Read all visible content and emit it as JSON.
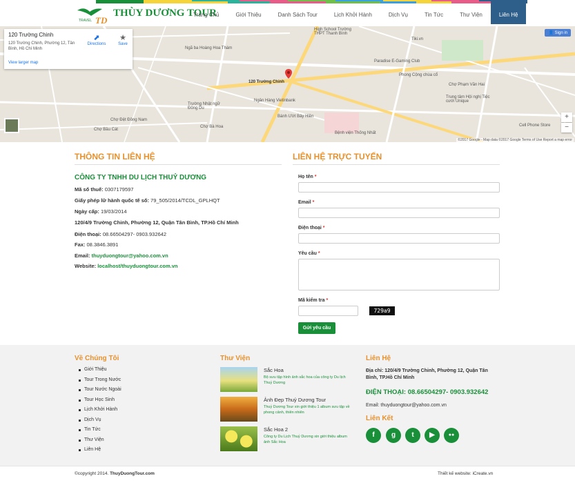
{
  "brand": {
    "logo_small": "TRAVEL",
    "logo_mark": "TD",
    "name": "THÙY DƯƠNG TOUR",
    "green": "#1a8f3a",
    "orange": "#e8912c",
    "nav_active_bg": "#2e5f8a"
  },
  "nav": [
    {
      "label": "Trang Chủ",
      "color": "#f5d43b"
    },
    {
      "label": "Giới Thiệu",
      "color": "#2bb39b"
    },
    {
      "label": "Danh Sách Tour",
      "color": "#e85c8a"
    },
    {
      "label": "Lịch Khởi Hành",
      "color": "#6fc04a"
    },
    {
      "label": "Dịch Vụ",
      "color": "#3aa0e0"
    },
    {
      "label": "Tin Tức",
      "color": "#f5d43b"
    },
    {
      "label": "Thư Viện",
      "color": "#e85c8a"
    },
    {
      "label": "Liên Hệ",
      "color": "#2e5f8a"
    }
  ],
  "map": {
    "place_title": "120 Trường Chinh",
    "place_address": "120 Trường Chinh, Phường 12, Tân Bình, Hồ Chí Minh",
    "directions": "Directions",
    "save": "Save",
    "larger": "View larger map",
    "signin": "Sign in",
    "pin_label": "120 Trường Chinh",
    "footer": "©2017 Google - Map data ©2017 Google    Terms of Use    Report a map error",
    "labels": [
      "High School Trường THPT Thanh Bình",
      "Paradise E-Gaming Club",
      "Phong Cộng chùa cổ",
      "Chợ Phạm Văn Hai",
      "Trung tâm Hội nghị Tiệc cưới Unique",
      "Ngân Hàng Vietinbank",
      "Bệnh viện Thống Nhất",
      "Bánh Ướt Bảy Hiền",
      "Trường Nhật ngữ Đông Du",
      "Chợ Bà Hoa",
      "Chợ Đệt Đồng Nam",
      "Chợ Bầu Cát",
      "Cell Phone Store",
      "Tiki.vn",
      "Ngã ba Hoàng Hoa Thám"
    ]
  },
  "contact_info": {
    "heading": "THÔNG TIN LIÊN HỆ",
    "company": "CÔNG TY TNHH DU LỊCH THUỶ DƯƠNG",
    "tax_label": "Mã số thuế:",
    "tax": "0307179597",
    "license_label": "Giấy phép lữ hành quốc tế số:",
    "license": "79_505/2014/TCDL_GPLHQT",
    "date_label": "Ngày cấp:",
    "date": "19/03/2014",
    "address": "120/4/9 Trường Chinh, Phường 12, Quận Tân Bình, TP.Hồ Chí Minh",
    "phone_label": "Điện thoại:",
    "phone": "08.66504297- 0903.932642",
    "fax_label": "Fax:",
    "fax": "08.3846.3891",
    "email_label": "Email:",
    "email": "thuyduongtour@yahoo.com.vn",
    "web_label": "Website:",
    "web": "localhost/thuyduongtour.com.vn"
  },
  "form": {
    "heading": "LIÊN HỆ TRỰC TUYẾN",
    "name_label": "Họ tên",
    "email_label": "Email",
    "phone_label": "Điện thoại",
    "request_label": "Yêu cầu",
    "captcha_label": "Mã kiểm tra",
    "captcha_code": "729a9",
    "req": "*",
    "submit": "Gửi yêu cầu"
  },
  "footer": {
    "about_heading": "Về Chúng Tôi",
    "about_links": [
      "Giới Thiệu",
      "Tour Trong Nước",
      "Tour Nước Ngoài",
      "Tour Học Sinh",
      "Lịch Khởi Hành",
      "Dịch Vụ",
      "Tin Tức",
      "Thư Viện",
      "Liên Hệ"
    ],
    "gallery_heading": "Thư Viện",
    "gallery": [
      {
        "title": "Sắc Hoa",
        "desc": "Bộ sưu tập hình ảnh sắc hoa của công ty Du lịch Thuỷ Dương"
      },
      {
        "title": "Ảnh Đẹp Thuỷ Dương Tour",
        "desc": "Thuỷ Dương Tour xin giới thiệu 1 album sưu tập về phong cảnh, thiên nhiên"
      },
      {
        "title": "Sắc Hoa 2",
        "desc": "Công ty Du Lịch Thuỷ Dương xin giới thiệu album ảnh Sắc Hoa"
      }
    ],
    "contact_heading": "Liên Hệ",
    "address": "Địa chỉ: 120/4/9 Trường Chinh, Phường 12, Quận Tân Bình, TP.Hồ Chí Minh",
    "phone": "ĐIỆN THOẠI: 08.66504297- 0903.932642",
    "email": "Email: thuyduongtour@yahoo.com.vn",
    "links_heading": "Liên Kết",
    "social": [
      "f",
      "g",
      "t",
      "▶",
      "●●"
    ],
    "copyright_prefix": "©copyright 2014.",
    "copyright_site": "ThuyDuongTour.com",
    "designer": "Thiết kế website: iCreate.vn"
  }
}
